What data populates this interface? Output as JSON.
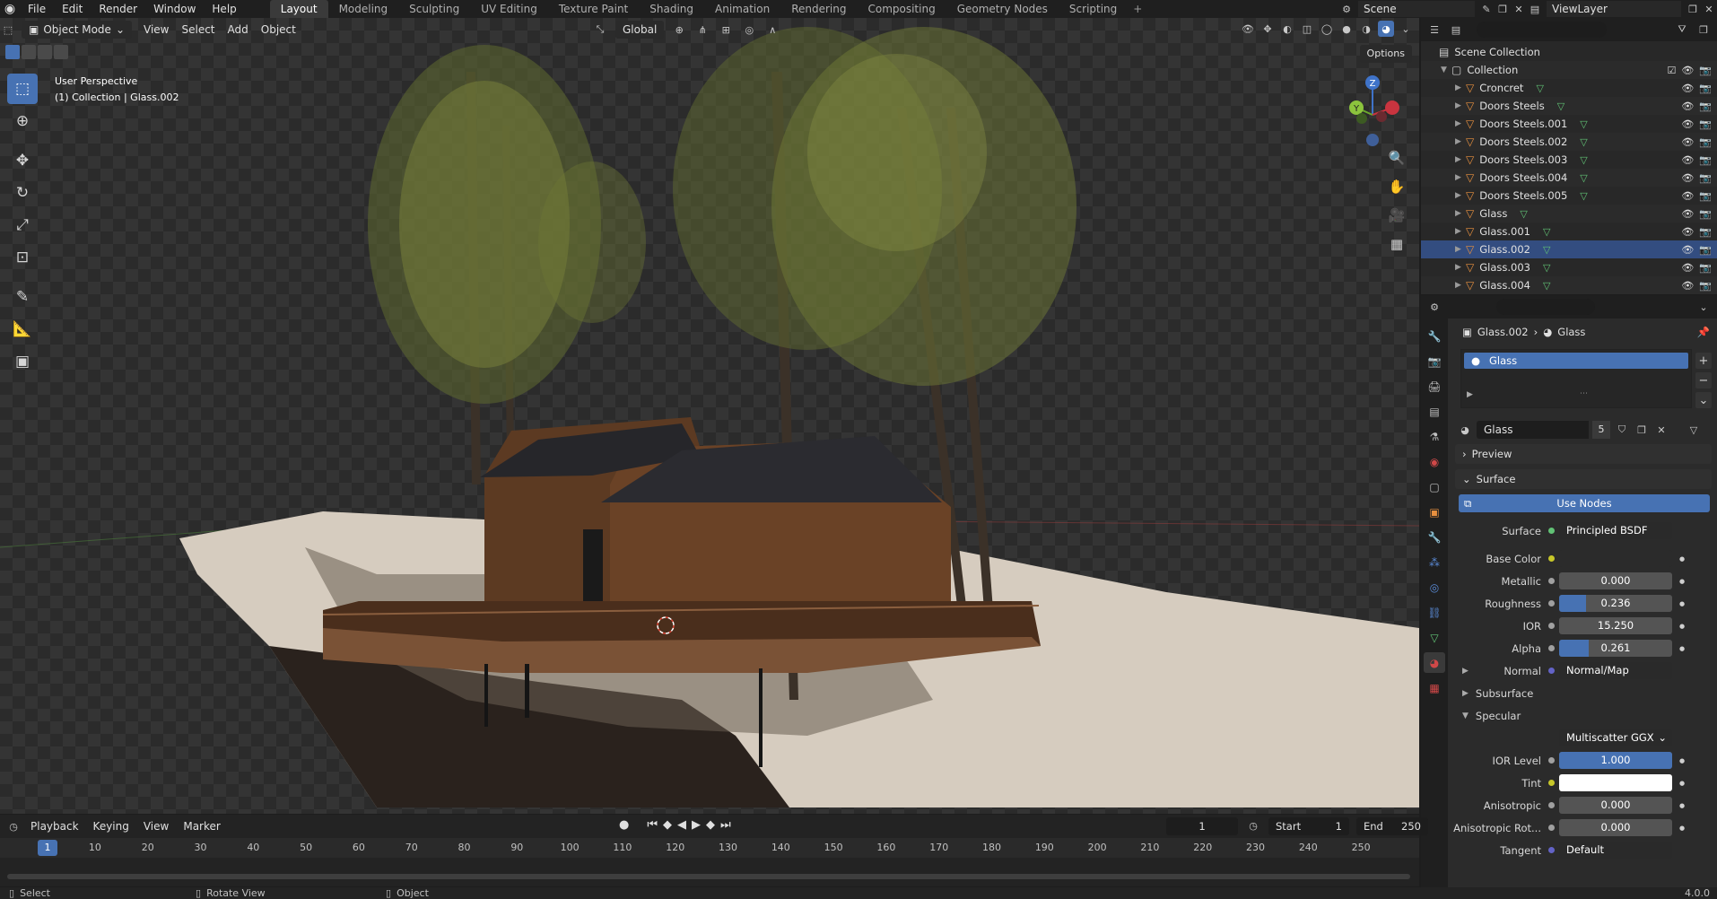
{
  "topbar": {
    "menus": [
      "File",
      "Edit",
      "Render",
      "Window",
      "Help"
    ],
    "workspaces": [
      "Layout",
      "Modeling",
      "Sculpting",
      "UV Editing",
      "Texture Paint",
      "Shading",
      "Animation",
      "Rendering",
      "Compositing",
      "Geometry Nodes",
      "Scripting"
    ],
    "active_workspace": "Layout",
    "add_tab": "+",
    "scene": "Scene",
    "view_layer": "ViewLayer"
  },
  "viewport": {
    "mode": "Object Mode",
    "menus": [
      "View",
      "Select",
      "Add",
      "Object"
    ],
    "orientation": "Global",
    "options": "Options",
    "info_line1": "User Perspective",
    "info_line2": "(1) Collection | Glass.002",
    "gizmo_axes": [
      "Z",
      "Y",
      "X"
    ],
    "accent_color": "#4772b3"
  },
  "outliner": {
    "search_placeholder": "",
    "scene_collection": "Scene Collection",
    "collection": "Collection",
    "objects": [
      "Croncret",
      "Doors Steels",
      "Doors Steels.001",
      "Doors Steels.002",
      "Doors Steels.003",
      "Doors Steels.004",
      "Doors Steels.005",
      "Glass",
      "Glass.001",
      "Glass.002",
      "Glass.003",
      "Glass.004"
    ],
    "selected_object": "Glass.002"
  },
  "properties": {
    "breadcrumb_object": "Glass.002",
    "breadcrumb_material": "Glass",
    "slot_name": "Glass",
    "material_name": "Glass",
    "material_users": "5",
    "panels": {
      "preview": "Preview",
      "surface": "Surface",
      "use_nodes": "Use Nodes"
    },
    "rows": {
      "surface": {
        "label": "Surface",
        "value": "Principled BSDF"
      },
      "base_color": {
        "label": "Base Color"
      },
      "metallic": {
        "label": "Metallic",
        "value": "0.000",
        "fill": 0.0
      },
      "roughness": {
        "label": "Roughness",
        "value": "0.236",
        "fill": 0.236
      },
      "ior": {
        "label": "IOR",
        "value": "15.250",
        "fill": 0.0
      },
      "alpha": {
        "label": "Alpha",
        "value": "0.261",
        "fill": 0.261
      },
      "normal": {
        "label": "Normal",
        "value": "Normal/Map"
      },
      "subsurface": {
        "label": "Subsurface"
      },
      "specular": {
        "label": "Specular"
      },
      "distribution": {
        "value": "Multiscatter GGX"
      },
      "ior_level": {
        "label": "IOR Level",
        "value": "1.000",
        "fill": 1.0
      },
      "tint": {
        "label": "Tint"
      },
      "anisotropic": {
        "label": "Anisotropic",
        "value": "0.000",
        "fill": 0.0
      },
      "anisotropic_rot": {
        "label": "Anisotropic Rot...",
        "value": "0.000",
        "fill": 0.0
      },
      "tangent": {
        "label": "Tangent",
        "value": "Default"
      }
    }
  },
  "timeline": {
    "menus": [
      "Playback",
      "Keying",
      "View",
      "Marker"
    ],
    "current_frame": "1",
    "start_label": "Start",
    "start": "1",
    "end_label": "End",
    "end": "250",
    "ticks": [
      "1",
      "10",
      "20",
      "30",
      "40",
      "50",
      "60",
      "70",
      "80",
      "90",
      "100",
      "110",
      "120",
      "130",
      "140",
      "150",
      "160",
      "170",
      "180",
      "190",
      "200",
      "210",
      "220",
      "230",
      "240",
      "250"
    ]
  },
  "statusbar": {
    "select": "Select",
    "rotate": "Rotate View",
    "object": "Object",
    "version": "4.0.0"
  }
}
